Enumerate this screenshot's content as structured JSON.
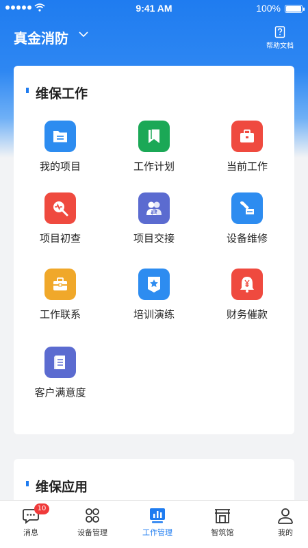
{
  "status_bar": {
    "time": "9:41 AM",
    "battery": "100%"
  },
  "header": {
    "org_name": "真金消防",
    "help_label": "帮助文档"
  },
  "maintenance_work": {
    "title": "维保工作",
    "items": [
      {
        "label": "我的项目",
        "icon": "folder-icon",
        "color": "#2d8cf0"
      },
      {
        "label": "工作计划",
        "icon": "bookmark-icon",
        "color": "#1ba856"
      },
      {
        "label": "当前工作",
        "icon": "briefcase-icon",
        "color": "#ef4a3f"
      },
      {
        "label": "项目初查",
        "icon": "search-pulse-icon",
        "color": "#ef4a3f"
      },
      {
        "label": "项目交接",
        "icon": "handover-icon",
        "color": "#5b6bd0"
      },
      {
        "label": "设备维修",
        "icon": "wrench-icon",
        "color": "#2d8cf0"
      },
      {
        "label": "工作联系",
        "icon": "case-icon",
        "color": "#f0a82a"
      },
      {
        "label": "培训演练",
        "icon": "star-badge-icon",
        "color": "#2d8cf0"
      },
      {
        "label": "财务催款",
        "icon": "yuan-bell-icon",
        "color": "#ef4a3f"
      },
      {
        "label": "客户满意度",
        "icon": "document-icon",
        "color": "#5b6bd0"
      }
    ]
  },
  "maintenance_apps": {
    "title": "维保应用"
  },
  "tabbar": {
    "tabs": [
      {
        "label": "消息",
        "icon": "message-icon",
        "badge": "10"
      },
      {
        "label": "设备管理",
        "icon": "grid-icon"
      },
      {
        "label": "工作管理",
        "icon": "chart-icon",
        "active": true
      },
      {
        "label": "智筑馆",
        "icon": "shop-icon"
      },
      {
        "label": "我的",
        "icon": "user-icon"
      }
    ]
  },
  "colors": {
    "accent": "#1f7cf0",
    "badge": "#f03a3a"
  }
}
